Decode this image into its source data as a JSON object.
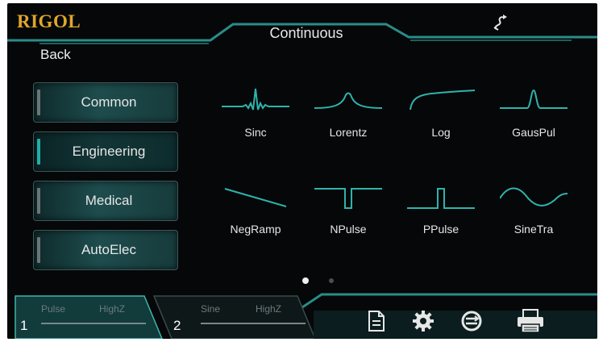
{
  "header": {
    "brand": "RIGOL",
    "title": "Continuous",
    "back_label": "Back"
  },
  "categories": [
    {
      "label": "Common",
      "active": false
    },
    {
      "label": "Engineering",
      "active": true
    },
    {
      "label": "Medical",
      "active": false
    },
    {
      "label": "AutoElec",
      "active": false
    }
  ],
  "waveforms": [
    {
      "label": "Sinc"
    },
    {
      "label": "Lorentz"
    },
    {
      "label": "Log"
    },
    {
      "label": "GausPul"
    },
    {
      "label": "NegRamp"
    },
    {
      "label": "NPulse"
    },
    {
      "label": "PPulse"
    },
    {
      "label": "SineTra"
    }
  ],
  "pagination": {
    "current": 1,
    "total": 2
  },
  "channels": [
    {
      "number": "1",
      "function": "Pulse",
      "load": "HighZ"
    },
    {
      "number": "2",
      "function": "Sine",
      "load": "HighZ"
    }
  ],
  "toolbar_icons": [
    "document-icon",
    "gear-icon",
    "sync-loop-icon",
    "printer-icon"
  ],
  "colors": {
    "accent": "#1fb0a8",
    "brand": "#e0a62c",
    "background": "#050709"
  }
}
